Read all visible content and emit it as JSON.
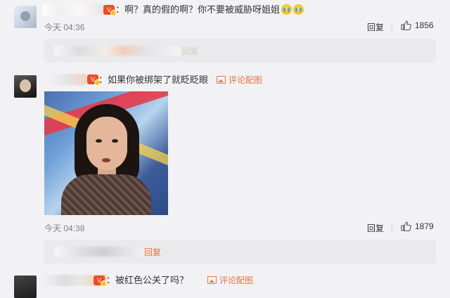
{
  "comments": [
    {
      "text": "：啊？真的假的啊？你不要被威胁呀姐姐",
      "time": "今天 04:36",
      "reply_label": "回复",
      "likes": "1856",
      "sub_reply": {
        "reply_label": "回复"
      }
    },
    {
      "text": "：如果你被绑架了就眨眨眼",
      "image_tag": "评论配图",
      "time": "今天 04:38",
      "reply_label": "回复",
      "likes": "1879",
      "sub_reply": {
        "reply_label": "回复"
      }
    },
    {
      "text": "：被红色公关了吗？",
      "image_tag": "评论配图"
    }
  ],
  "colors": {
    "background": "#f2f2f5",
    "accent": "#eb7340",
    "vip_badge": "#f04c1e",
    "sub_reply_bg": "#eaeaec"
  },
  "icons": {
    "like": "thumbs-up-icon",
    "image_tag": "image-icon",
    "emoji": "crying-emoji-icon",
    "vip": "vip-badge-icon"
  }
}
